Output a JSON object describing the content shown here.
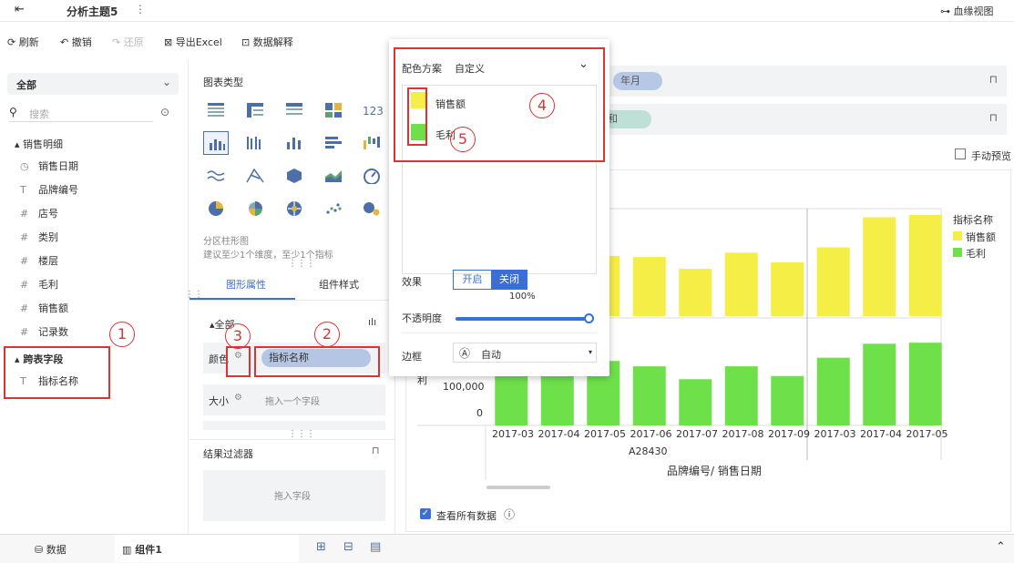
{
  "header": {
    "title": "分析主题5",
    "more": "⋮",
    "lineage": "血缘视图"
  },
  "toolbar": {
    "refresh": "刷新",
    "undo": "撤销",
    "redo": "还原",
    "export": "导出Excel",
    "explain": "数据解释"
  },
  "left": {
    "scope": "全部",
    "search_placeholder": "搜索",
    "group1": "销售明细",
    "fields": [
      {
        "icon": "◷",
        "label": "销售日期"
      },
      {
        "icon": "T",
        "label": "品牌编号"
      },
      {
        "icon": "#",
        "label": "店号"
      },
      {
        "icon": "#",
        "label": "类别"
      },
      {
        "icon": "#",
        "label": "楼层"
      },
      {
        "icon": "#",
        "label": "毛利"
      },
      {
        "icon": "#",
        "label": "销售额"
      },
      {
        "icon": "#",
        "label": "记录数"
      }
    ],
    "group2": "跨表字段",
    "cross_field": "指标名称"
  },
  "mid": {
    "chart_type_title": "图表类型",
    "chart_desc1": "分区柱形图",
    "chart_desc2": "建议至少1个维度，至少1个指标",
    "tab_props": "图形属性",
    "tab_style": "组件样式",
    "all": "全部",
    "color_label": "颜色",
    "color_field": "指标名称",
    "size_label": "大小",
    "size_placeholder": "拖入一个字段",
    "filter_title": "结果过滤器",
    "filter_drop": "拖入字段"
  },
  "popup": {
    "scheme_label": "配色方案",
    "scheme_value": "自定义",
    "legend": [
      {
        "name": "销售额",
        "color": "#f5ee46"
      },
      {
        "name": "毛利",
        "color": "#6ee14a"
      }
    ],
    "effect_label": "效果",
    "on": "开启",
    "off": "关闭",
    "opacity_pct": "100%",
    "opacity_label": "不透明度",
    "border_label": "边框",
    "border_value": "自动",
    "border_icon": "Ⓐ"
  },
  "annotations": [
    "1",
    "2",
    "3",
    "4",
    "5"
  ],
  "right": {
    "chip1": "年月",
    "chip2": "和",
    "manual_preview": "手动预览",
    "legend_title": "指标名称",
    "y_tick_100k": "100,000",
    "y_tick_0": "0",
    "y_partial": "利",
    "x_group": "A28430",
    "x_title": "品牌编号/ 销售日期",
    "view_all": "查看所有数据"
  },
  "chart_data": {
    "type": "bar",
    "categories": [
      "2017-03",
      "2017-04",
      "2017-05",
      "2017-06",
      "2017-07",
      "2017-08",
      "2017-09",
      "2017-03",
      "2017-04",
      "2017-05"
    ],
    "series": [
      {
        "name": "销售额",
        "color": "#f5ee46",
        "values": [
          0.5,
          0.5,
          0.56,
          0.55,
          0.44,
          0.59,
          0.5,
          0.64,
          0.92,
          0.94
        ]
      },
      {
        "name": "毛利",
        "color": "#6ee14a",
        "values": [
          0.55,
          0.6,
          0.6,
          0.55,
          0.43,
          0.55,
          0.46,
          0.63,
          0.76,
          0.77
        ]
      }
    ]
  },
  "bottom": {
    "data_tab": "数据",
    "widget_tab": "组件1"
  }
}
